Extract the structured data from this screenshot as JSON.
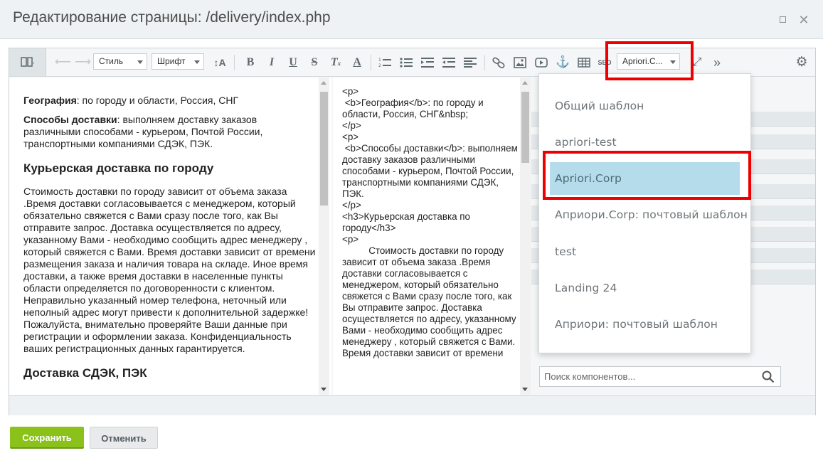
{
  "window": {
    "title": "Редактирование страницы: /delivery/index.php"
  },
  "toolbar": {
    "style_select": "Стиль",
    "font_select": "Шрифт",
    "template_select": "Apriori.C..."
  },
  "wysiwyg": {
    "p1_bold": "География",
    "p1_text": ": по городу и области, Россия, СНГ",
    "p2_bold": "Способы доставки",
    "p2_text": ": выполняем доставку заказов различными способами - курьером, Почтой России, транспортными компаниями СДЭК, ПЭК.",
    "h3_1": "Курьерская доставка по городу",
    "p3": "Стоимость доставки по городу зависит от объема заказа .Время доставки согласовывается с менеджером, который обязательно свяжется с Вами сразу после того, как Вы отправите запрос. Доставка осуществляется по адресу, указанному Вами - необходимо сообщить адрес менеджеру , который свяжется с Вами. Время доставки зависит от времени размещения заказа и наличия товара на складе. Иное время доставки, а также время доставки в населенные пункты области определяется по договоренности с клиентом. Неправильно указанный номер телефона, неточный или неполный адрес могут привести к дополнительной задержке! Пожалуйста, внимательно проверяйте Ваши данные при регистрации и оформлении заказа. Конфиденциальность ваших регистрационных данных гарантируется.",
    "h3_2": "Доставка СДЭК, ПЭК"
  },
  "code": {
    "source": "<p>\n <b>География</b>: по городу и области, Россия, СНГ&nbsp;\n</p>\n<p>\n <b>Способы доставки</b>: выполняем доставку заказов различными способами - курьером, Почтой России, транспортными компаниями СДЭК, ПЭК.\n</p>\n<h3>Курьерская доставка по городу</h3>\n<p>\n\t  Стоимость доставки по городу зависит от объема заказа .Время доставки согласовывается с менеджером, который обязательно свяжется с Вами сразу после того, как Вы отправите запрос. Доставка осуществляется по адресу, указанному Вами - необходимо сообщить адрес менеджеру , который свяжется с Вами. Время доставки зависит от времени"
  },
  "components": {
    "search_placeholder": "Поиск компонентов..."
  },
  "template_dropdown": {
    "items": [
      "Общий шаблон",
      "apriori-test",
      "Apriori.Corp",
      "Априори.Corp: почтовый шаблон",
      "test",
      "Landing 24",
      "Априори: почтовый шаблон"
    ],
    "selected": "Apriori.Corp"
  },
  "footer": {
    "save_label": "Сохранить",
    "cancel_label": "Отменить"
  },
  "colors": {
    "highlight": "#ee0000",
    "selected_item": "#b5dceb",
    "save_button": "#8ac11b"
  }
}
